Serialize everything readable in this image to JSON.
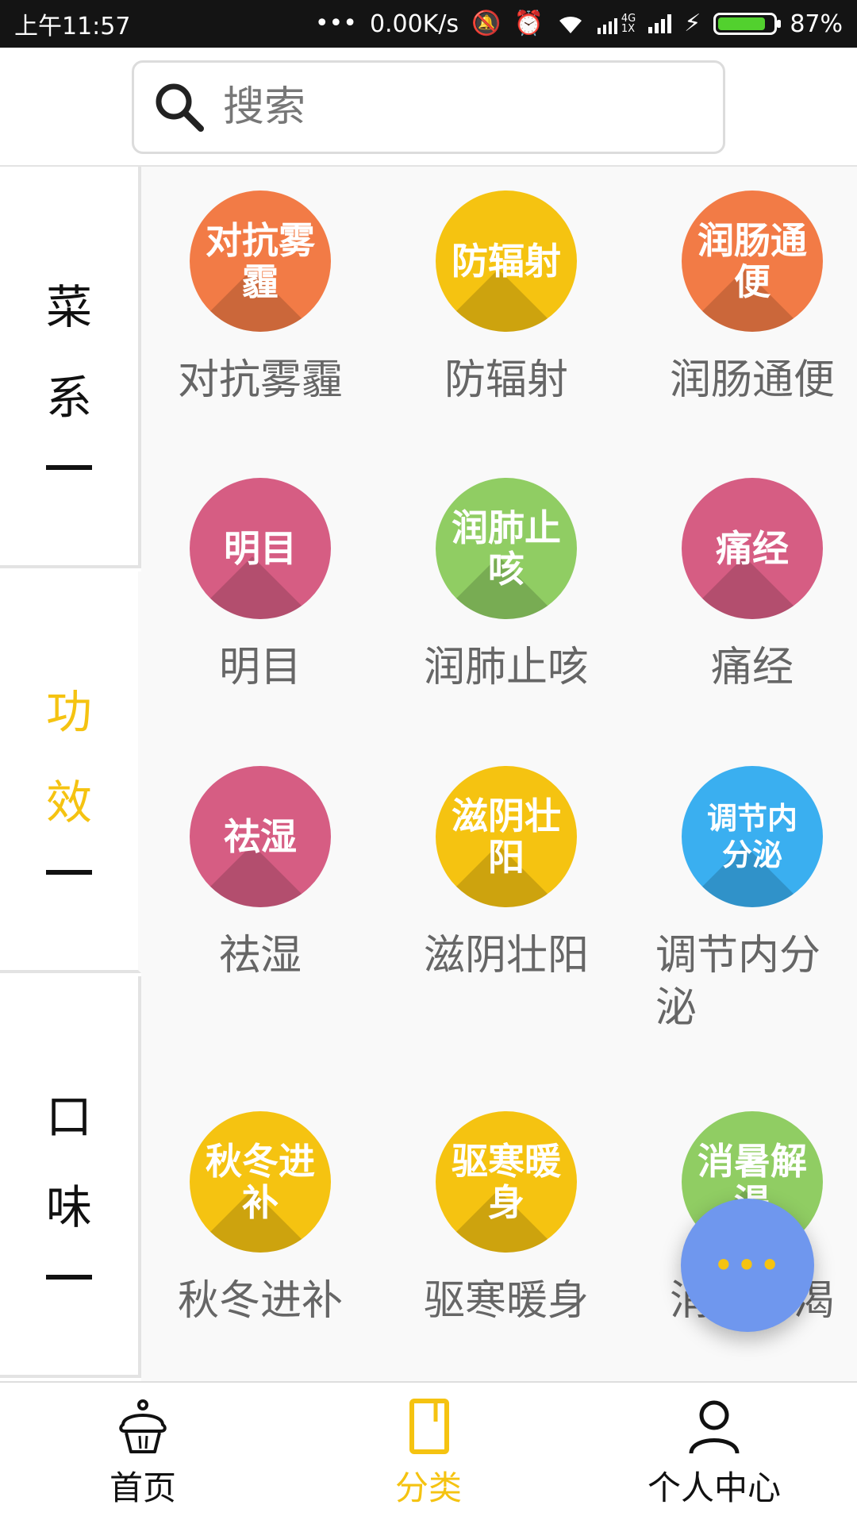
{
  "status_bar": {
    "time": "上午11:57",
    "speed": "0.00K/s",
    "network": "4G",
    "network_sub": "1X",
    "battery": "87%",
    "battery_level": 0.87
  },
  "search": {
    "placeholder": "搜索",
    "value": ""
  },
  "sidebar": {
    "tabs": [
      {
        "chars": [
          "菜",
          "系"
        ],
        "active": false
      },
      {
        "chars": [
          "功",
          "效"
        ],
        "active": true
      },
      {
        "chars": [
          "口",
          "味"
        ],
        "active": false
      }
    ]
  },
  "grid": {
    "items": [
      {
        "badge": "对抗雾霾",
        "label": "对抗雾霾",
        "color": "#f27b46"
      },
      {
        "badge": "防辐射",
        "label": "防辐射",
        "color": "#f5c311"
      },
      {
        "badge": "润肠通便",
        "label": "润肠通便",
        "color": "#f27b46"
      },
      {
        "badge": "明目",
        "label": "明目",
        "color": "#d65d83"
      },
      {
        "badge": "润肺止咳",
        "label": "润肺止咳",
        "color": "#90cd63"
      },
      {
        "badge": "痛经",
        "label": "痛经",
        "color": "#d65d83"
      },
      {
        "badge": "祛湿",
        "label": "祛湿",
        "color": "#d65d83"
      },
      {
        "badge": "滋阴壮阳",
        "label": "滋阴壮阳",
        "color": "#f5c311"
      },
      {
        "badge": "调节内分泌",
        "label": "调节内分泌",
        "color": "#3aaff0"
      },
      {
        "badge": "秋冬进补",
        "label": "秋冬进补",
        "color": "#f5c311"
      },
      {
        "badge": "驱寒暖身",
        "label": "驱寒暖身",
        "color": "#f5c311"
      },
      {
        "badge": "消暑解渴",
        "label": "消暑解渴",
        "color": "#90cd63"
      }
    ]
  },
  "fab": {
    "label": "•••"
  },
  "bottom_nav": {
    "items": [
      {
        "label": "首页",
        "icon": "cupcake-icon",
        "active": false
      },
      {
        "label": "分类",
        "icon": "book-icon",
        "active": true
      },
      {
        "label": "个人中心",
        "icon": "user-icon",
        "active": false
      }
    ]
  },
  "colors": {
    "accent": "#f5c311",
    "fab": "#6f97ee",
    "status_bar": "#141414"
  }
}
